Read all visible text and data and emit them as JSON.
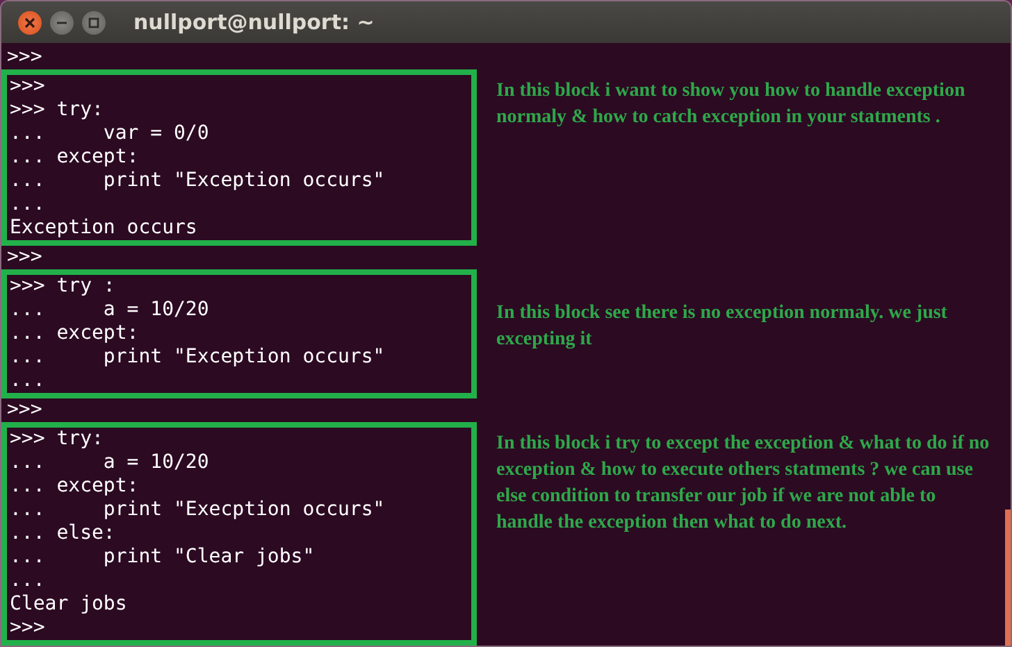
{
  "window": {
    "title": "nullport@nullport: ~"
  },
  "segments": [
    {
      "kind": "line",
      "text": ">>>"
    },
    {
      "kind": "block",
      "lines": [
        ">>>",
        ">>> try:",
        "...     var = 0/0",
        "... except:",
        "...     print \"Exception occurs\"",
        "...",
        "Exception occurs"
      ],
      "note": "In this block i want to show you how to handle exception normaly & how to catch exception in your statments ."
    },
    {
      "kind": "line",
      "text": ">>>"
    },
    {
      "kind": "block",
      "lines": [
        ">>> try :",
        "...     a = 10/20",
        "... except:",
        "...     print \"Exception occurs\"",
        "..."
      ],
      "note": "In this block see there is no exception normaly. we just excepting it"
    },
    {
      "kind": "line",
      "text": ">>>"
    },
    {
      "kind": "block",
      "lines": [
        ">>> try:",
        "...     a = 10/20",
        "... except:",
        "...     print \"Execption occurs\"",
        "... else:",
        "...     print \"Clear jobs\"",
        "...",
        "Clear jobs",
        ">>>"
      ],
      "note": "In this block i try to except the exception & what to do if no exception & how to execute others statments ? we can use else condition to transfer our job if we are not able to handle the exception then what to do next."
    }
  ]
}
